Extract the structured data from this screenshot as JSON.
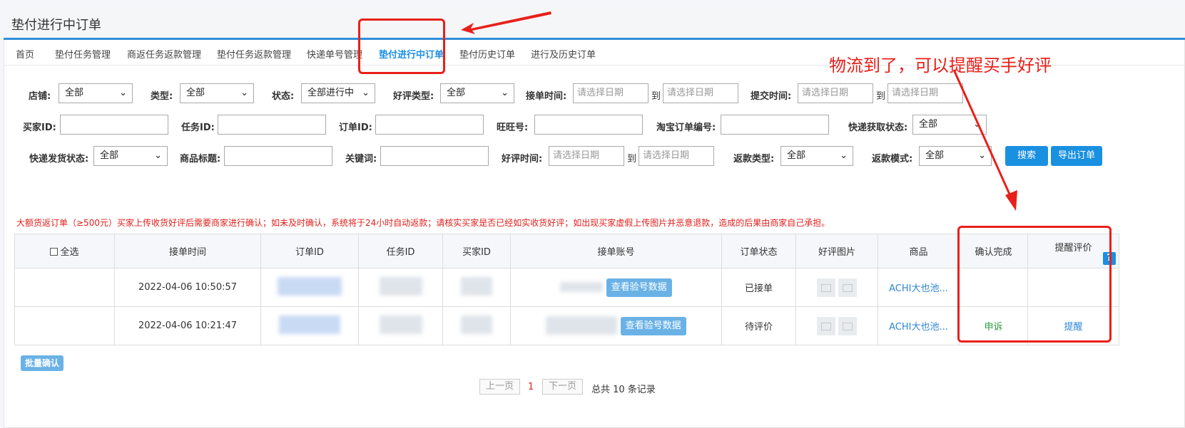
{
  "page": {
    "title": "垫付进行中订单"
  },
  "tabs": [
    {
      "label": "首页"
    },
    {
      "label": "垫付任务管理"
    },
    {
      "label": "商返任务返款管理"
    },
    {
      "label": "垫付任务返款管理"
    },
    {
      "label": "快递单号管理"
    },
    {
      "label": "垫付进行中订单",
      "active": true
    },
    {
      "label": "垫付历史订单"
    },
    {
      "label": "进行及历史订单"
    }
  ],
  "filters": {
    "shop": {
      "label": "店铺:",
      "value": "全部"
    },
    "type": {
      "label": "类型:",
      "value": "全部"
    },
    "status": {
      "label": "状态:",
      "value": "全部进行中"
    },
    "review_type": {
      "label": "好评类型:",
      "value": "全部"
    },
    "accept_time": {
      "label": "接单时间:",
      "from_placeholder": "请选择日期",
      "to_placeholder": "请选择日期"
    },
    "submit_time": {
      "label": "提交时间:",
      "from_placeholder": "请选择日期",
      "to_placeholder": "请选择日期"
    },
    "buyer_id": {
      "label": "买家ID:",
      "value": ""
    },
    "task_id": {
      "label": "任务ID:",
      "value": ""
    },
    "order_id": {
      "label": "订单ID:",
      "value": ""
    },
    "wangwang": {
      "label": "旺旺号:",
      "value": ""
    },
    "taobao_order": {
      "label": "淘宝订单编号:",
      "value": ""
    },
    "express_fetch_status": {
      "label": "快递获取状态:",
      "value": "全部"
    },
    "express_ship_status": {
      "label": "快递发货状态:",
      "value": "全部"
    },
    "product_title": {
      "label": "商品标题:",
      "value": ""
    },
    "keyword": {
      "label": "关键词:",
      "value": ""
    },
    "review_time": {
      "label": "好评时间:",
      "from_placeholder": "请选择日期",
      "to_placeholder": "请选择日期"
    },
    "refund_type": {
      "label": "返款类型:",
      "value": "全部"
    },
    "refund_mode": {
      "label": "返款模式:",
      "value": "全部"
    },
    "to_label": "到"
  },
  "buttons": {
    "search": "搜索",
    "export": "导出订单",
    "batch_confirm": "批量确认",
    "view_account": "查看验号数据"
  },
  "notice": "大额货返订单（≥500元）买家上传收货好评后需要商家进行确认；如未及时确认，系统将于24小时自动返款；请核实买家是否已经如实收货好评；如出现买家虚假上传图片并恶意退款，造成的后果由商家自己承担。",
  "table": {
    "headers": {
      "select_all": "全选",
      "accept_time": "接单时间",
      "order_id": "订单ID",
      "task_id": "任务ID",
      "buyer_id": "买家ID",
      "account": "接单账号",
      "order_status": "订单状态",
      "review_images": "好评图片",
      "product": "商品",
      "confirm": "确认完成",
      "remind": "提醒评价"
    },
    "help_icon": "?",
    "rows": [
      {
        "accept_time": "2022-04-06 10:50:57",
        "status": "已接单",
        "product": "ACHI大也池...",
        "confirm": "",
        "remind": ""
      },
      {
        "accept_time": "2022-04-06 10:21:47",
        "status": "待评价",
        "product": "ACHI大也池...",
        "confirm": "申诉",
        "remind": "提醒"
      }
    ]
  },
  "pagination": {
    "prev": "上一页",
    "current": "1",
    "next": "下一页",
    "total": "总共 10 条记录"
  },
  "annotation": {
    "text": "物流到了，可以提醒买手好评",
    "color": "#e8201a"
  },
  "colors": {
    "accent": "#1a90e0",
    "annotation": "#e8201a",
    "notice": "#e0201c"
  }
}
